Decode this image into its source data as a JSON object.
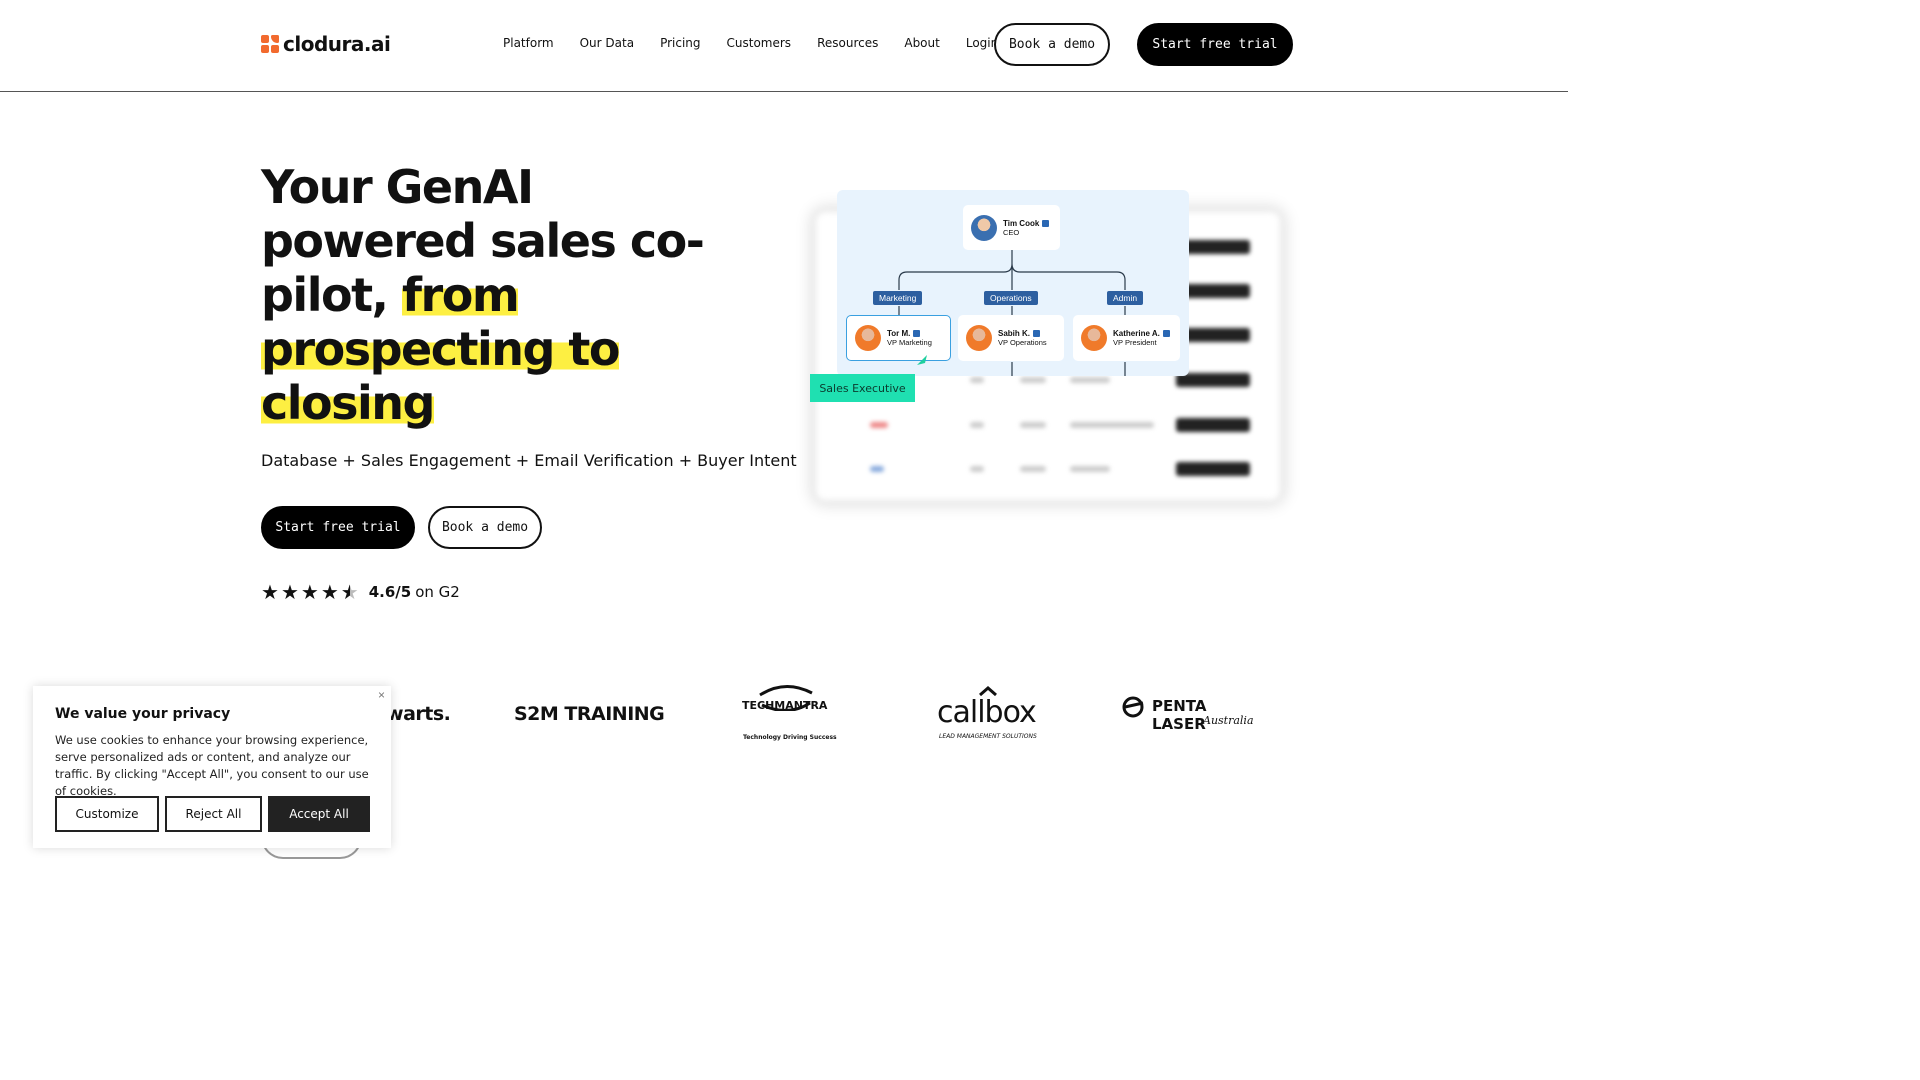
{
  "header": {
    "logo_text": "clodura.ai",
    "nav": [
      "Platform",
      "Our Data",
      "Pricing",
      "Customers",
      "Resources",
      "About",
      "Login"
    ],
    "book_demo": "Book a demo",
    "start_trial": "Start free trial"
  },
  "hero": {
    "title_plain": "Your GenAI powered sales co-pilot, ",
    "title_highlight": "from prospecting to closing",
    "subtitle": "Database + Sales Engagement + Email Verification + Buyer Intent",
    "start_trial": "Start free trial",
    "book_demo": "Book a demo",
    "rating_value": "4.6/5",
    "rating_suffix": "on G2",
    "stars": 4.5
  },
  "org_chart": {
    "ceo": {
      "name": "Tim Cook",
      "role": "CEO"
    },
    "departments": [
      "Marketing",
      "Operations",
      "Admin"
    ],
    "people": [
      {
        "name": "Tor M.",
        "role": "VP Marketing"
      },
      {
        "name": "Sabih K.",
        "role": "VP Operations"
      },
      {
        "name": "Katherine A.",
        "role": "VP President"
      }
    ],
    "tag": "Sales Executive"
  },
  "customer_logos": [
    "lwarts.",
    "S2M TRAINING",
    "TECHMANTRA",
    "Technology Driving Success",
    "callbox",
    "LEAD MANAGEMENT SOLUTIONS",
    "PENTA LASER",
    "Australia"
  ],
  "cookie": {
    "title": "We value your privacy",
    "text": "We use cookies to enhance your browsing experience, serve personalized ads or content, and analyze our traffic. By clicking \"Accept All\", you consent to our use of cookies.",
    "customize": "Customize",
    "reject": "Reject All",
    "accept": "Accept All",
    "close": "×"
  }
}
